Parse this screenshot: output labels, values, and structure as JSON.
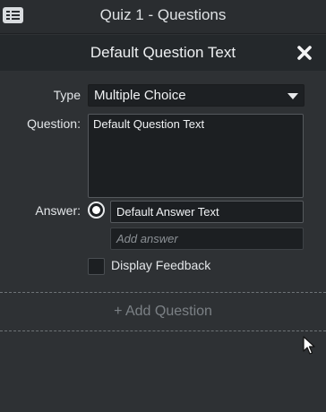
{
  "window": {
    "title": "Quiz 1 - Questions"
  },
  "panel": {
    "title": "Default Question Text"
  },
  "form": {
    "type_label": "Type",
    "type_value": "Multiple Choice",
    "question_label": "Question:",
    "question_value": "Default Question Text",
    "answer_label": "Answer:",
    "answer_value": "Default Answer Text",
    "add_answer_placeholder": "Add answer",
    "display_feedback_label": "Display Feedback"
  },
  "add_question_label": "+ Add Question",
  "icons": {
    "menu": "list-menu-icon",
    "close": "close-icon",
    "dropdown": "chevron-down-icon",
    "cursor": "mouse-pointer-icon"
  }
}
